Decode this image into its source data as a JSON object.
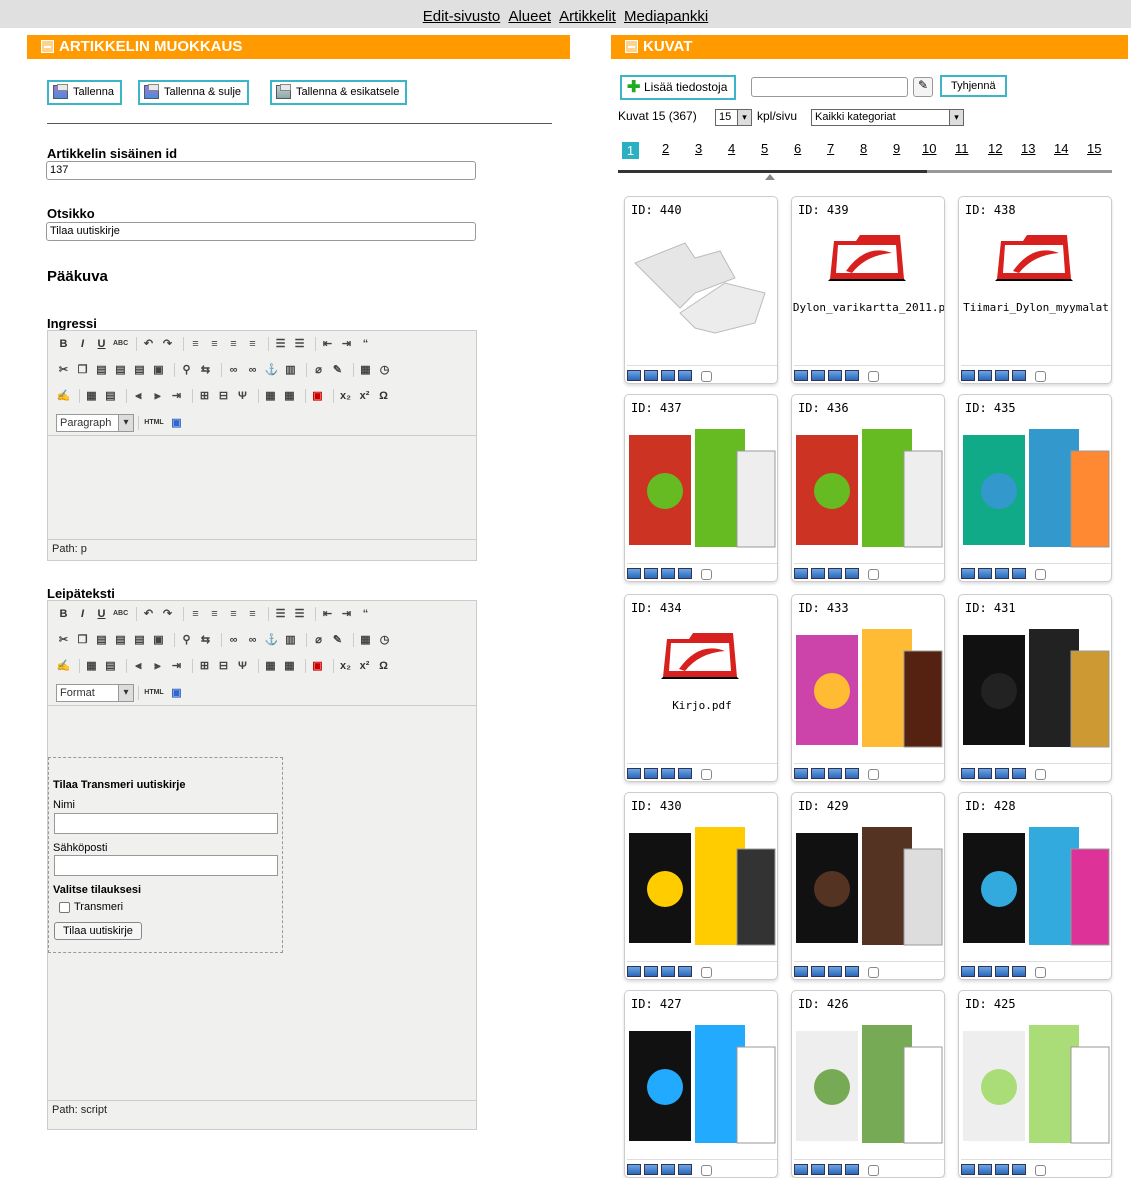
{
  "topnav": {
    "items": [
      "Edit-sivusto",
      "Alueet",
      "Artikkelit",
      "Mediapankki"
    ]
  },
  "left": {
    "title": "ARTIKKELIN MUOKKAUS",
    "buttons": {
      "save": "Tallenna",
      "save_close": "Tallenna & sulje",
      "save_preview": "Tallenna & esikatsele"
    },
    "internal_id_label": "Artikkelin sisäinen id",
    "internal_id_value": "137",
    "title_label": "Otsikko",
    "title_value": "Tilaa uutiskirje",
    "main_image_label": "Pääkuva",
    "ingress_label": "Ingressi",
    "ingress_format": "Paragraph",
    "ingress_path": "Path: p",
    "body_label": "Leipäteksti",
    "body_format": "Format",
    "body_path": "Path: script",
    "html_label": "HTML",
    "form": {
      "title": "Tilaa Transmeri uutiskirje",
      "name_label": "Nimi",
      "email_label": "Sähköposti",
      "choose_label": "Valitse tilauksesi",
      "option": "Transmeri",
      "submit": "Tilaa uutiskirje"
    }
  },
  "right": {
    "title": "KUVAT",
    "add_files": "Lisää tiedostoja",
    "clear": "Tyhjennä",
    "count_text": "Kuvat 15 (367)",
    "per_page": "15",
    "per_page_suffix": "kpl/sivu",
    "category": "Kaikki kategoriat",
    "pages": [
      "1",
      "2",
      "3",
      "4",
      "5",
      "6",
      "7",
      "8",
      "9",
      "10",
      "11",
      "12",
      "13",
      "14",
      "15"
    ],
    "current_page": "1",
    "tiles": [
      {
        "id": "ID: 440",
        "kind": "puzzle",
        "name": ""
      },
      {
        "id": "ID: 439",
        "kind": "pdf",
        "name": "Dylon_varikartta_2011.p"
      },
      {
        "id": "ID: 438",
        "kind": "pdf",
        "name": "Tiimari_Dylon_myymalat"
      },
      {
        "id": "ID: 437",
        "kind": "packs-green",
        "name": ""
      },
      {
        "id": "ID: 436",
        "kind": "packs-green",
        "name": ""
      },
      {
        "id": "ID: 435",
        "kind": "sprays",
        "name": ""
      },
      {
        "id": "ID: 434",
        "kind": "pdf",
        "name": "Kirjo.pdf"
      },
      {
        "id": "ID: 433",
        "kind": "tea",
        "name": ""
      },
      {
        "id": "ID: 431",
        "kind": "dylon-black",
        "name": ""
      },
      {
        "id": "ID: 430",
        "kind": "dylon-sun",
        "name": ""
      },
      {
        "id": "ID: 429",
        "kind": "dylon-wash",
        "name": ""
      },
      {
        "id": "ID: 428",
        "kind": "dylon-color",
        "name": ""
      },
      {
        "id": "ID: 427",
        "kind": "dylon-wash2",
        "name": ""
      },
      {
        "id": "ID: 426",
        "kind": "bottles",
        "name": ""
      },
      {
        "id": "ID: 425",
        "kind": "bottles2",
        "name": ""
      }
    ]
  },
  "colors": {
    "accent": "#ff9a00",
    "button_border": "#3cb6c6",
    "pdf_red": "#d8201e"
  }
}
